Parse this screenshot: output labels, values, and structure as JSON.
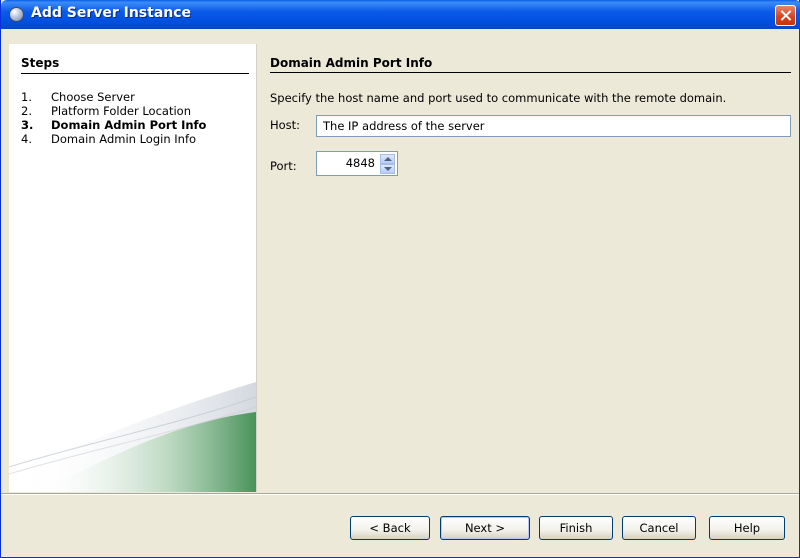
{
  "window": {
    "title": "Add Server Instance"
  },
  "steps": {
    "heading": "Steps",
    "items": [
      {
        "num": "1.",
        "label": "Choose Server",
        "current": false
      },
      {
        "num": "2.",
        "label": "Platform Folder Location",
        "current": false
      },
      {
        "num": "3.",
        "label": "Domain Admin Port Info",
        "current": true
      },
      {
        "num": "4.",
        "label": "Domain Admin Login Info",
        "current": false
      }
    ]
  },
  "panel": {
    "heading": "Domain Admin Port Info",
    "instructions": "Specify the host name and port used to communicate with the remote domain.",
    "host_label": "Host:",
    "host_value": "The IP address of the server",
    "port_label": "Port:",
    "port_value": "4848"
  },
  "buttons": {
    "back": "< Back",
    "next": "Next >",
    "finish": "Finish",
    "cancel": "Cancel",
    "help": "Help"
  },
  "colors": {
    "titlebar": "#0050e0",
    "dialog_bg": "#ece9d8",
    "close_button": "#d4421a"
  }
}
